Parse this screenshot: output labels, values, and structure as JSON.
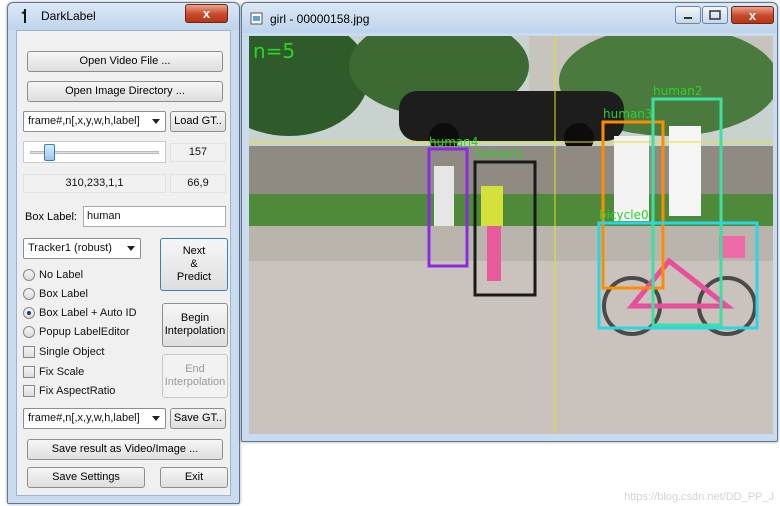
{
  "left_window": {
    "title": "DarkLabel",
    "close_label": "x",
    "open_video_label": "Open Video File ...",
    "open_image_dir_label": "Open Image Directory ...",
    "format_select_value": "frame#,n[,x,y,w,h,label]",
    "load_gt_label": "Load GT..",
    "frame_number": "157",
    "frame_slider_position": 0.12,
    "box_info": "310,233,1,1",
    "cursor_info": "66,9",
    "box_label_caption": "Box Label:",
    "box_label_value": "human",
    "tracker_select_value": "Tracker1 (robust)",
    "next_predict_label": "Next\n&\nPredict",
    "radio_options": [
      {
        "label": "No Label",
        "selected": false
      },
      {
        "label": "Box Label",
        "selected": false
      },
      {
        "label": "Box Label + Auto ID",
        "selected": true
      },
      {
        "label": "Popup LabelEditor",
        "selected": false
      }
    ],
    "checkboxes": [
      {
        "label": "Single Object",
        "checked": false
      },
      {
        "label": "Fix Scale",
        "checked": false
      },
      {
        "label": "Fix AspectRatio",
        "checked": false
      }
    ],
    "begin_interp_label": "Begin\nInterpolation",
    "end_interp_label": "End\nInterpolation",
    "save_format_value": "frame#,n[,x,y,w,h,label]",
    "save_gt_label": "Save GT..",
    "save_result_label": "Save result as Video/Image ...",
    "save_settings_label": "Save Settings",
    "exit_label": "Exit"
  },
  "right_window": {
    "title": "girl - 00000158.jpg",
    "object_count": "n=5",
    "boxes": [
      {
        "label": "human4",
        "color": "#8a2be2"
      },
      {
        "label": "human1",
        "color": "#1a1a1a"
      },
      {
        "label": "human3",
        "color": "#ff8c00"
      },
      {
        "label": "human2",
        "color": "#3de0a0"
      },
      {
        "label": "bicycle0",
        "color": "#2ad6e6"
      }
    ],
    "label_text_color": "#2bd22b",
    "crosshair_color": "#e6e21a"
  },
  "watermark": "https://blog.csdn.net/DD_PP_J"
}
